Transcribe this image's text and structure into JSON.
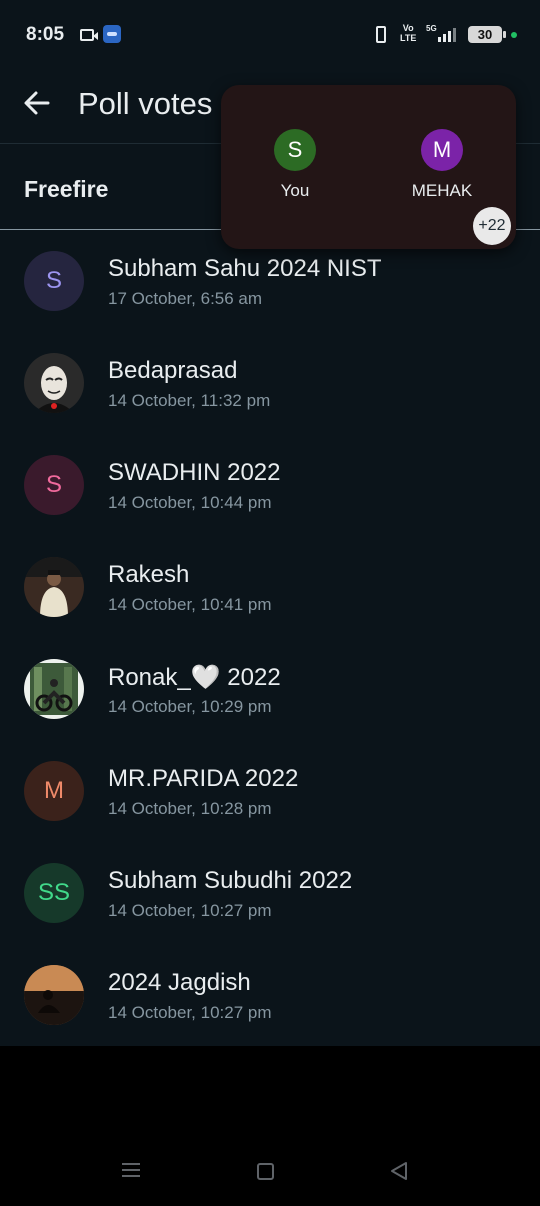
{
  "status_bar": {
    "time": "8:05",
    "volte": "Vo\nLTE",
    "network": "5G",
    "battery": "30"
  },
  "header": {
    "title": "Poll votes"
  },
  "option": {
    "title": "Freefire"
  },
  "popup": {
    "voters": [
      {
        "initial": "S",
        "name": "You",
        "color": "#2c6b24"
      },
      {
        "initial": "M",
        "name": "MEHAK",
        "color": "#7b23a8"
      }
    ],
    "more_count": "+22"
  },
  "voters": [
    {
      "name": "Subham Sahu 2024 NIST",
      "time": "17 October, 6:56 am",
      "initial": "S",
      "bg": "#25253f",
      "fg": "#9c95f0",
      "photo": false
    },
    {
      "name": "Bedaprasad",
      "time": "14 October, 11:32 pm",
      "initial": "",
      "photo": true,
      "photo_kind": "mask"
    },
    {
      "name": "SWADHIN 2022",
      "time": "14 October, 10:44 pm",
      "initial": "S",
      "bg": "#3a1a2c",
      "fg": "#f06a9c",
      "photo": false
    },
    {
      "name": "Rakesh",
      "time": "14 October, 10:41 pm",
      "initial": "",
      "photo": true,
      "photo_kind": "person"
    },
    {
      "name": "Ronak_🤍 2022",
      "time": "14 October, 10:29 pm",
      "initial": "",
      "photo": true,
      "photo_kind": "bike"
    },
    {
      "name": "MR.PARIDA 2022",
      "time": "14 October, 10:28 pm",
      "initial": "M",
      "bg": "#3b221b",
      "fg": "#ef8a6a",
      "photo": false
    },
    {
      "name": "Subham Subudhi 2022",
      "time": "14 October, 10:27 pm",
      "initial": "SS",
      "bg": "#16392a",
      "fg": "#41d98a",
      "photo": false
    },
    {
      "name": "2024 Jagdish",
      "time": "14 October, 10:27 pm",
      "initial": "",
      "photo": true,
      "photo_kind": "sunset"
    }
  ],
  "icons": {
    "back": "arrow-left-icon",
    "nav_menu": "recent-apps-icon",
    "nav_home": "home-icon",
    "nav_back": "nav-back-icon"
  }
}
